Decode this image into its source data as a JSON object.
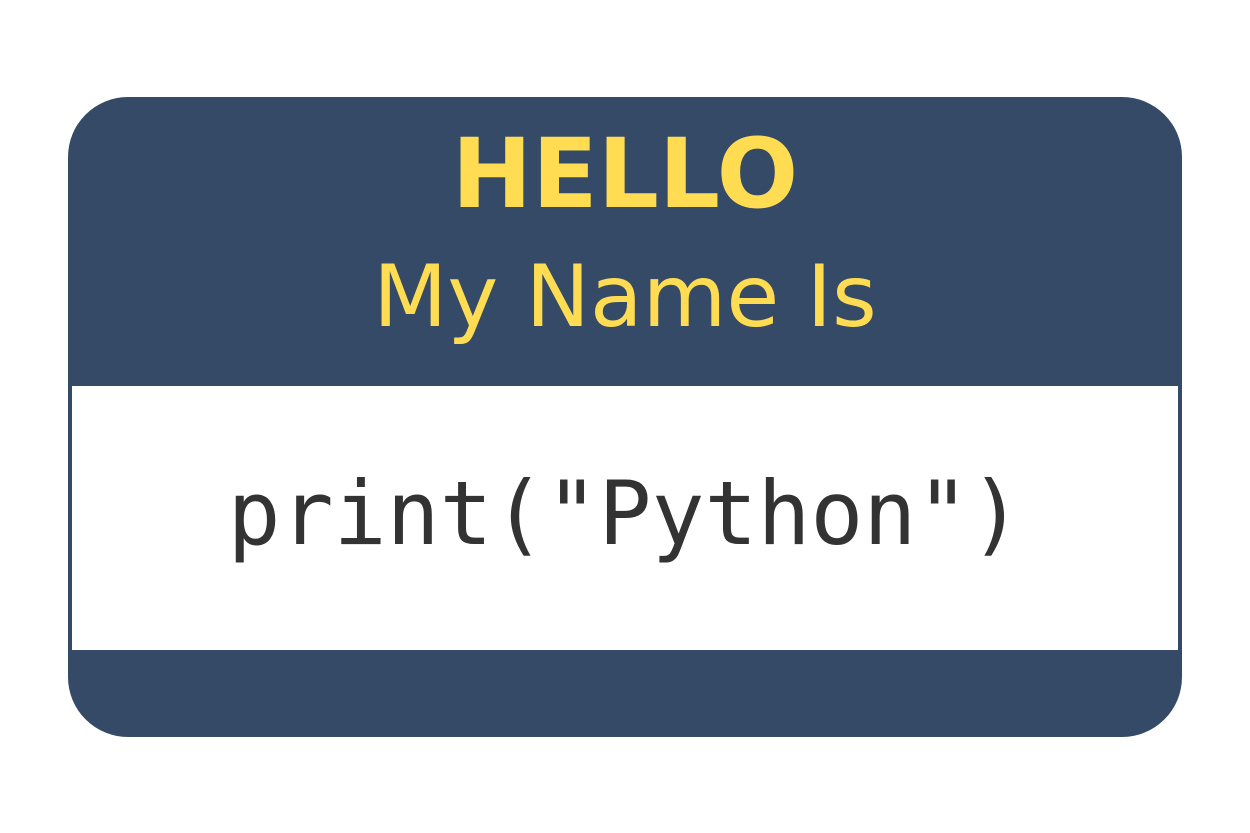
{
  "badge": {
    "greeting": "HELLO",
    "subtitle": "My Name Is",
    "name": "print(\"Python\")"
  },
  "colors": {
    "badge_background": "#354a66",
    "greeting_text": "#ffdc52",
    "name_area": "#ffffff",
    "name_text": "#333333"
  }
}
